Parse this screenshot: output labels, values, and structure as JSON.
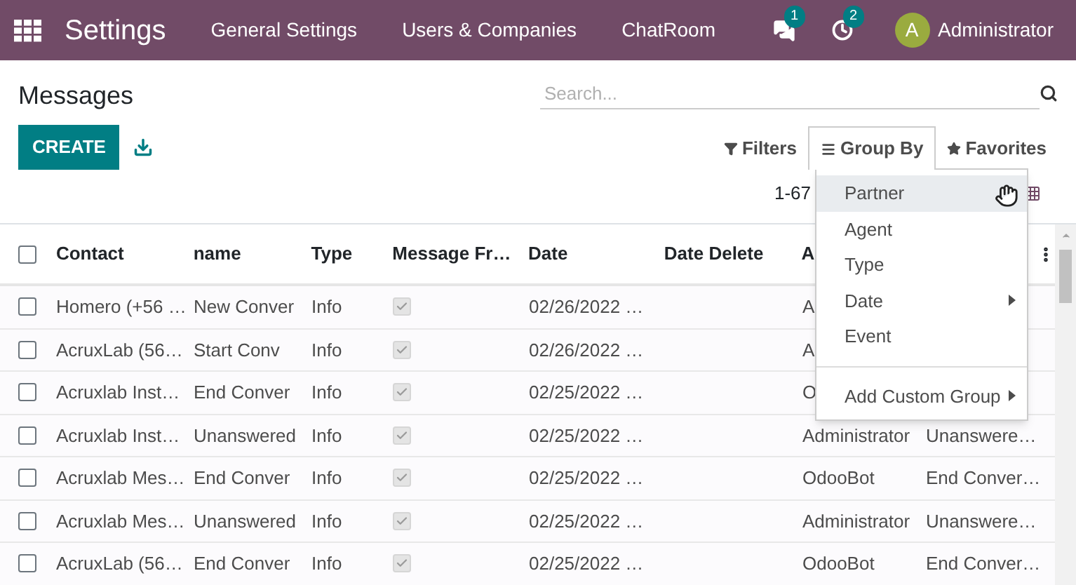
{
  "navbar": {
    "app_title": "Settings",
    "menus": [
      "General Settings",
      "Users & Companies",
      "ChatRoom"
    ],
    "messages_badge": "1",
    "activity_badge": "2",
    "avatar_letter": "A",
    "user": "Administrator"
  },
  "page": {
    "title": "Messages",
    "create_label": "CREATE",
    "search": {
      "placeholder": "Search..."
    },
    "filters_label": "Filters",
    "groupby_label": "Group By",
    "favorites_label": "Favorites",
    "pager": "1-67",
    "groupby_open": true
  },
  "groupby_menu": [
    {
      "label": "Partner",
      "selected": true,
      "submenu": false
    },
    {
      "label": "Agent",
      "selected": false,
      "submenu": false
    },
    {
      "label": "Type",
      "selected": false,
      "submenu": false
    },
    {
      "label": "Date",
      "selected": false,
      "submenu": true
    },
    {
      "label": "Event",
      "selected": false,
      "submenu": false
    },
    {
      "label": "Add Custom Group",
      "selected": false,
      "submenu": true,
      "divider_before": true
    }
  ],
  "table": {
    "all_selected": false,
    "columns": [
      "Contact",
      "name",
      "Type",
      "Message Fr…",
      "Date",
      "Date Delete",
      "A"
    ],
    "rows": [
      {
        "selected": false,
        "contact": "Homero (+56 …",
        "name": "New Conver",
        "type": "Info",
        "message_from": true,
        "date": "02/26/2022 …",
        "agent": "A"
      },
      {
        "selected": false,
        "contact": "AcruxLab (56…",
        "name": "Start Conv",
        "type": "Info",
        "message_from": true,
        "date": "02/26/2022 …",
        "agent": "A"
      },
      {
        "selected": false,
        "contact": "Acruxlab Inst…",
        "name": "End Conver",
        "type": "Info",
        "message_from": true,
        "date": "02/25/2022 …",
        "agent": "O"
      },
      {
        "selected": false,
        "contact": "Acruxlab Inst…",
        "name": "Unanswered",
        "type": "Info",
        "message_from": true,
        "date": "02/25/2022 …",
        "agent": "Administrator",
        "column_8": "Unanswere…"
      },
      {
        "selected": false,
        "contact": "Acruxlab Mes…",
        "name": "End Conver",
        "type": "Info",
        "message_from": true,
        "date": "02/25/2022 …",
        "agent": "OdooBot",
        "column_8": "End Conver…"
      },
      {
        "selected": false,
        "contact": "Acruxlab Mes…",
        "name": "Unanswered",
        "type": "Info",
        "message_from": true,
        "date": "02/25/2022 …",
        "agent": "Administrator",
        "column_8": "Unanswere…"
      },
      {
        "selected": false,
        "contact": "AcruxLab (56…",
        "name": "End Conver",
        "type": "Info",
        "message_from": true,
        "date": "02/25/2022 …",
        "agent": "OdooBot",
        "column_8": "End Conver…"
      }
    ]
  }
}
